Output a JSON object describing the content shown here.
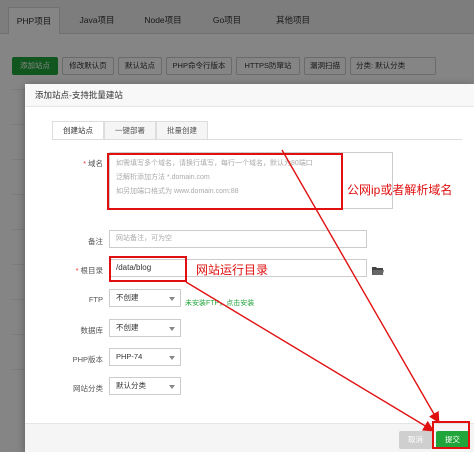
{
  "top_tabs": [
    "PHP项目",
    "Java项目",
    "Node项目",
    "Go项目",
    "其他项目"
  ],
  "toolbar": {
    "add_site": "添加站点",
    "default_page": "修改默认页",
    "default_site": "默认站点",
    "php_cli": "PHP命令行版本",
    "https_firewall": "HTTPS防窜站",
    "vuln_scan": "漏洞扫描",
    "category_select": "分类: 默认分类"
  },
  "dialog": {
    "title": "添加站点-支持批量建站",
    "tabs": [
      "创建站点",
      "一键部署",
      "批量创建"
    ],
    "domain": {
      "label": "域名",
      "required": "*",
      "placeholder_lines": [
        "如需填写多个域名，请换行填写，每行一个域名，默认为80端口",
        "泛解析添加方法 *.domain.com",
        "如另加端口格式为 www.domain.com:88"
      ]
    },
    "remark": {
      "label": "备注",
      "placeholder": "网站备注，可为空"
    },
    "root": {
      "label": "根目录",
      "required": "*",
      "value": "/data/blog"
    },
    "ftp": {
      "label": "FTP",
      "value": "不创建",
      "note": "未安装FTP，点击安装"
    },
    "database": {
      "label": "数据库",
      "value": "不创建"
    },
    "php_version": {
      "label": "PHP版本",
      "value": "PHP-74"
    },
    "category": {
      "label": "网站分类",
      "value": "默认分类"
    },
    "cancel": "取消",
    "submit": "提交"
  },
  "annotations": {
    "domain_note": "公网ip或者解析域名",
    "root_note": "网站运行目录"
  },
  "colors": {
    "accent": "#20a53a",
    "annotation": "#e01010"
  }
}
